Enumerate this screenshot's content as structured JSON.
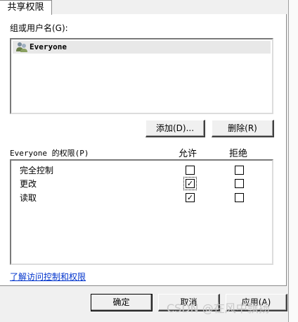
{
  "tab": {
    "label": "共享权限"
  },
  "group_section": {
    "label": "组或用户名(G):",
    "users": [
      {
        "name": "Everyone",
        "icon": "users-group-icon"
      }
    ]
  },
  "buttons": {
    "add": "添加(D)...",
    "remove": "删除(R)"
  },
  "permissions": {
    "header": "Everyone 的权限(P)",
    "allow_header": "允许",
    "deny_header": "拒绝",
    "rows": [
      {
        "label": "完全控制",
        "allow": false,
        "deny": false
      },
      {
        "label": "更改",
        "allow": true,
        "deny": false
      },
      {
        "label": "读取",
        "allow": true,
        "deny": false
      }
    ]
  },
  "link": {
    "label": "了解访问控制和权限"
  },
  "footer": {
    "ok": "确定",
    "cancel": "取消",
    "apply": "应用(A)"
  },
  "watermark": "CSDN @在风中飘扬",
  "check_glyph": "✓"
}
